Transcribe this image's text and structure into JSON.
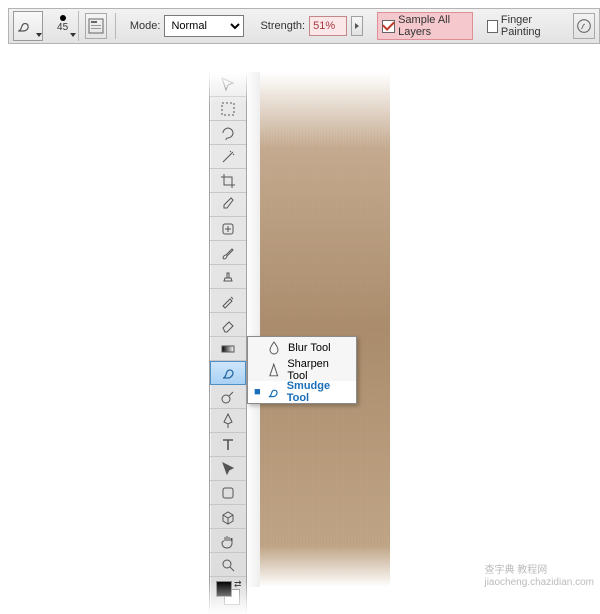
{
  "options_bar": {
    "tool_icon": "smudge-icon",
    "brush_size": "45",
    "mode_label": "Mode:",
    "mode_value": "Normal",
    "strength_label": "Strength:",
    "strength_value": "51%",
    "sample_all_layers_label": "Sample All Layers",
    "sample_all_layers_checked": true,
    "finger_painting_label": "Finger Painting",
    "finger_painting_checked": false
  },
  "flyout": {
    "items": [
      {
        "label": "Blur Tool",
        "icon": "blur-icon",
        "current": false
      },
      {
        "label": "Sharpen Tool",
        "icon": "sharpen-icon",
        "current": false
      },
      {
        "label": "Smudge Tool",
        "icon": "smudge-icon",
        "current": true
      }
    ]
  },
  "tools_palette": [
    "move-tool",
    "marquee-tool",
    "lasso-tool",
    "magic-wand-tool",
    "crop-tool",
    "eyedropper-tool",
    "healing-brush-tool",
    "brush-tool",
    "clone-stamp-tool",
    "history-brush-tool",
    "eraser-tool",
    "gradient-tool",
    "smudge-tool",
    "dodge-tool",
    "pen-tool",
    "type-tool",
    "path-selection-tool",
    "shape-tool",
    "3d-tool",
    "hand-tool",
    "zoom-tool"
  ],
  "watermark": {
    "main": "查字典  教程网",
    "sub": "jiaocheng.chazidian.com"
  }
}
